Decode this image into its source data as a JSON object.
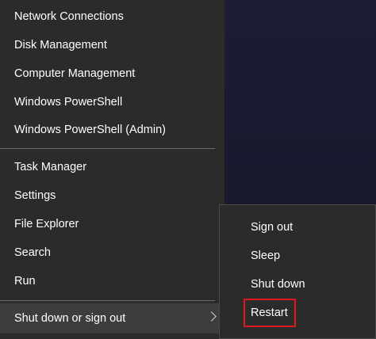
{
  "main_menu": {
    "items": [
      {
        "label": "Network Connections"
      },
      {
        "label": "Disk Management"
      },
      {
        "label": "Computer Management"
      },
      {
        "label": "Windows PowerShell"
      },
      {
        "label": "Windows PowerShell (Admin)"
      },
      {
        "label": "Task Manager"
      },
      {
        "label": "Settings"
      },
      {
        "label": "File Explorer"
      },
      {
        "label": "Search"
      },
      {
        "label": "Run"
      },
      {
        "label": "Shut down or sign out"
      }
    ]
  },
  "sub_menu": {
    "items": [
      {
        "label": "Sign out"
      },
      {
        "label": "Sleep"
      },
      {
        "label": "Shut down"
      },
      {
        "label": "Restart"
      }
    ]
  },
  "colors": {
    "menu_background": "#2b2b2b",
    "highlight": "#e0191f"
  }
}
